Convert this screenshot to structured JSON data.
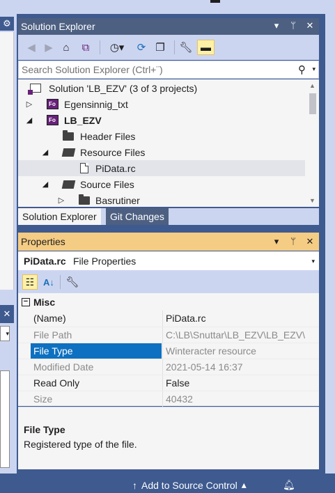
{
  "colors": {
    "accent": "#0e70c0",
    "title_active": "#f5cc84",
    "title_inactive": "#4d6082",
    "status_bar": "#3e5a8f"
  },
  "left": {
    "gear_icon": "gear-icon",
    "close_icon": "close-icon"
  },
  "solution_explorer": {
    "title": "Solution Explorer",
    "title_buttons": [
      "▾",
      "ᛘ",
      "✕"
    ],
    "search": {
      "placeholder": "Search Solution Explorer (Ctrl+¨)"
    },
    "toolbar_icons": [
      "back-icon",
      "forward-icon",
      "home-icon",
      "switch-views-icon",
      "pending-changes-filter-icon",
      "sync-icon",
      "collapse-all-icon",
      "properties-icon",
      "preview-selected-icon"
    ],
    "tree": {
      "solution": "Solution 'LB_EZV' (3 of 3 projects)",
      "items": [
        {
          "label": "Egensinnig_txt",
          "icon": "fortran-project-icon"
        },
        {
          "label": "LB_EZV",
          "icon": "fortran-project-icon"
        },
        {
          "label": "Header Files",
          "icon": "folder-icon"
        },
        {
          "label": "Resource Files",
          "icon": "folder-open-icon"
        },
        {
          "label": "PiData.rc",
          "icon": "file-icon"
        },
        {
          "label": "Source Files",
          "icon": "folder-open-icon"
        },
        {
          "label": "Basrutiner",
          "icon": "folder-icon"
        }
      ],
      "project_badge": "Fo"
    },
    "tabs": [
      {
        "label": "Solution Explorer"
      },
      {
        "label": "Git Changes"
      }
    ]
  },
  "properties": {
    "title": "Properties",
    "title_buttons": [
      "▾",
      "ᛘ",
      "✕"
    ],
    "object": {
      "name": "PiData.rc",
      "kind": "File Properties"
    },
    "category": "Misc",
    "collapse_glyph": "−",
    "rows": [
      {
        "name": "(Name)",
        "value": "PiData.rc"
      },
      {
        "name": "File Path",
        "value": "C:\\LB\\Snuttar\\LB_EZV\\LB_EZV\\"
      },
      {
        "name": "File Type",
        "value": "Winteracter resource"
      },
      {
        "name": "Modified Date",
        "value": "2021-05-14 16:37"
      },
      {
        "name": "Read Only",
        "value": "False"
      },
      {
        "name": "Size",
        "value": "40432"
      }
    ],
    "description": {
      "title": "File Type",
      "text": "Registered type of the file."
    }
  },
  "status_bar": {
    "source_control": "Add to Source Control",
    "source_control_arrow": "↑",
    "source_control_caret": "▴"
  }
}
